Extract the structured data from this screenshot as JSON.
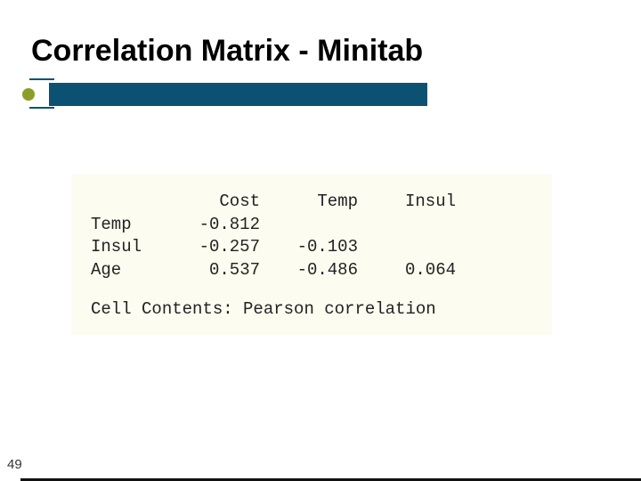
{
  "title": "Correlation Matrix - Minitab",
  "page_number": "49",
  "matrix": {
    "columns": [
      "Cost",
      "Temp",
      "Insul"
    ],
    "rows": [
      {
        "label": "Temp",
        "values": [
          "-0.812",
          "",
          ""
        ]
      },
      {
        "label": "Insul",
        "values": [
          "-0.257",
          "-0.103",
          ""
        ]
      },
      {
        "label": "Age",
        "values": [
          "0.537",
          "-0.486",
          "0.064"
        ]
      }
    ],
    "contents_label": "Cell Contents: Pearson correlation"
  },
  "chart_data": {
    "type": "table",
    "title": "Correlation Matrix - Minitab",
    "columns": [
      "",
      "Cost",
      "Temp",
      "Insul"
    ],
    "rows": [
      [
        "Temp",
        -0.812,
        null,
        null
      ],
      [
        "Insul",
        -0.257,
        -0.103,
        null
      ],
      [
        "Age",
        0.537,
        -0.486,
        0.064
      ]
    ],
    "note": "Cell Contents: Pearson correlation"
  }
}
